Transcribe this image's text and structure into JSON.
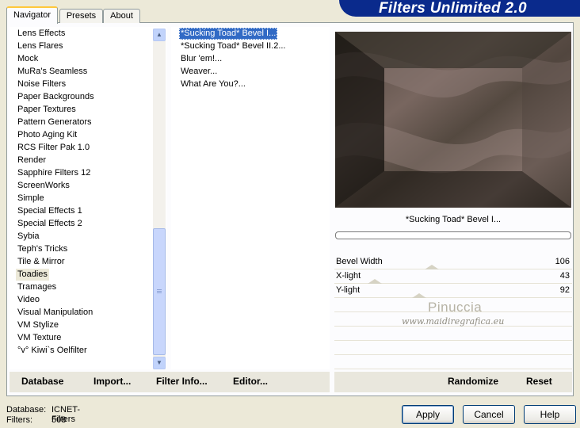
{
  "app": {
    "banner_title": "Filters Unlimited 2.0"
  },
  "tabs": [
    {
      "label": "Navigator",
      "active": true
    },
    {
      "label": "Presets",
      "active": false
    },
    {
      "label": "About",
      "active": false
    }
  ],
  "categories": {
    "items": [
      "Lens Effects",
      "Lens Flares",
      "Mock",
      "MuRa's Seamless",
      "Noise Filters",
      "Paper Backgrounds",
      "Paper Textures",
      "Pattern Generators",
      "Photo Aging Kit",
      "RCS Filter Pak 1.0",
      "Render",
      "Sapphire Filters 12",
      "ScreenWorks",
      "Simple",
      "Special Effects 1",
      "Special Effects 2",
      "Sybia",
      "Teph's Tricks",
      "Tile & Mirror",
      "Toadies",
      "Tramages",
      "Video",
      "Visual Manipulation",
      "VM Stylize",
      "VM Texture",
      "°v° Kiwi`s Oelfilter"
    ],
    "selected": "Toadies",
    "scroll_position": 0.86
  },
  "filters": {
    "items": [
      "*Sucking Toad*  Bevel I...",
      "*Sucking Toad*  Bevel II.2...",
      "Blur 'em!...",
      "Weaver...",
      "What Are You?..."
    ],
    "selected": "*Sucking Toad*  Bevel I..."
  },
  "preview": {
    "filter_name": "*Sucking Toad*  Bevel I...",
    "progress": 0
  },
  "params": [
    {
      "label": "Bevel Width",
      "value": "106"
    },
    {
      "label": "X-light",
      "value": "43"
    },
    {
      "label": "Y-light",
      "value": "92"
    }
  ],
  "watermark": {
    "line1": "Pinuccia",
    "line2": "www.maidiregrafica.eu"
  },
  "toolbar": {
    "database": "Database",
    "import": "Import...",
    "filter_info": "Filter Info...",
    "editor": "Editor...",
    "randomize": "Randomize",
    "reset": "Reset"
  },
  "status": {
    "database_label": "Database:",
    "database_value": "ICNET-Filters",
    "filters_label": "Filters:",
    "filters_value": "508"
  },
  "dialog": {
    "apply": "Apply",
    "cancel": "Cancel",
    "help": "Help"
  },
  "colors": {
    "banner": "#0a2a8c",
    "selection": "#316ac5",
    "active_tab_accent": "#ffc83c"
  }
}
